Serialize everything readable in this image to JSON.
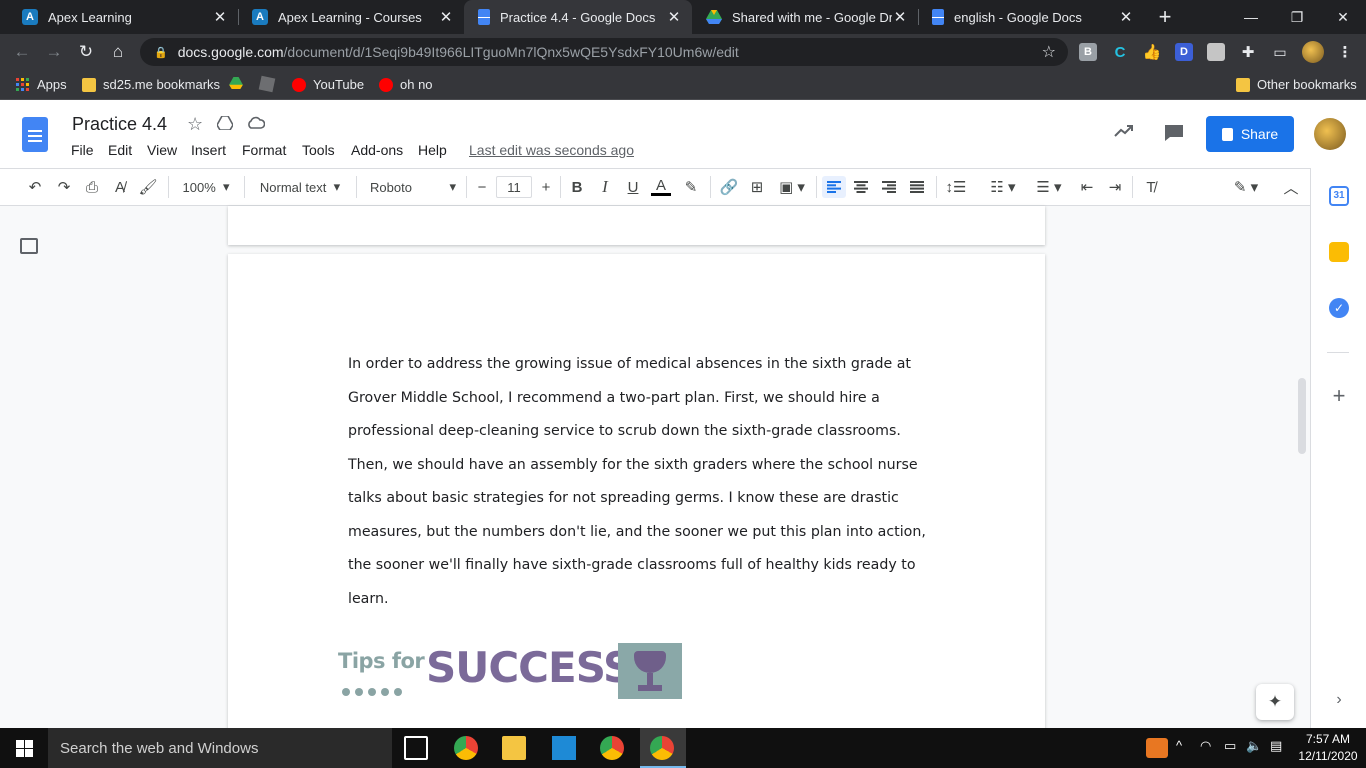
{
  "browser": {
    "tabs": [
      {
        "title": "Apex Learning",
        "icon": "apex-logo-icon",
        "active": false
      },
      {
        "title": "Apex Learning - Courses",
        "icon": "apex-logo-icon",
        "active": false
      },
      {
        "title": "Practice 4.4 - Google Docs",
        "icon": "google-docs-icon",
        "active": true
      },
      {
        "title": "Shared with me - Google Drive",
        "icon": "google-drive-icon",
        "active": false
      },
      {
        "title": "english - Google Docs",
        "icon": "google-docs-icon",
        "active": false
      }
    ],
    "url_host": "docs.google.com",
    "url_path": "/document/d/1Seqi9b49It966LITguoMn7lQnx5wQE5YsdxFY10Um6w/edit",
    "bookmarks": [
      {
        "label": "Apps",
        "icon": "apps-grid-icon"
      },
      {
        "label": "sd25.me bookmarks",
        "icon": "folder-icon"
      },
      {
        "label": "",
        "icon": "drive-icon"
      },
      {
        "label": "",
        "icon": "roblox-icon"
      },
      {
        "label": "YouTube",
        "icon": "youtube-icon"
      },
      {
        "label": "oh no",
        "icon": "youtube-icon"
      }
    ],
    "other_bookmarks": "Other bookmarks"
  },
  "docs": {
    "title": "Practice 4.4",
    "menu": [
      "File",
      "Edit",
      "View",
      "Insert",
      "Format",
      "Tools",
      "Add-ons",
      "Help"
    ],
    "last_edit": "Last edit was seconds ago",
    "share_label": "Share",
    "toolbar": {
      "zoom": "100%",
      "style": "Normal text",
      "font": "Roboto",
      "font_size": "11"
    },
    "body_text": "In order to address the growing issue of medical absences in the sixth grade at Grover Middle School, I recommend a two-part plan. First, we should hire a professional deep-cleaning service to scrub down the sixth-grade classrooms. Then, we should have an assembly for the sixth graders where the school nurse talks about basic strategies for not spreading germs. I know these are drastic measures, but the numbers don't lie, and the sooner we put this plan into action, the sooner we'll finally have sixth-grade classrooms full of healthy kids ready to learn.",
    "banner": {
      "small": "Tips for",
      "big": "SUCCESS"
    }
  },
  "taskbar": {
    "search_placeholder": "Search the web and Windows",
    "time": "7:57 AM",
    "date": "12/11/2020"
  },
  "colors": {
    "accent": "#1a73e8",
    "tab_strip": "#202124",
    "toolbar": "#35363a"
  }
}
